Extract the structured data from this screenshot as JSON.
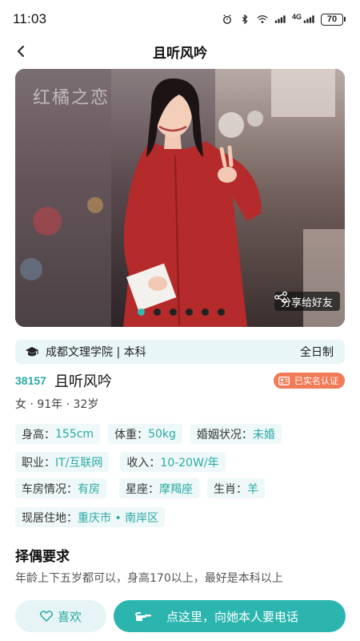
{
  "status_bar": {
    "time": "11:03",
    "battery": "70",
    "network_label": "4G"
  },
  "nav": {
    "title": "且听风吟"
  },
  "hero": {
    "watermark": "红橘之恋",
    "share_label": "分享给好友",
    "page_count": 6,
    "active_page": 1
  },
  "profile": {
    "school": "成都文理学院 | 本科",
    "study_mode": "全日制",
    "user_id": "38157",
    "nickname": "且听风吟",
    "verified_label": "已实名认证",
    "basic": "女 · 91年 · 32岁"
  },
  "details": {
    "row1": [
      {
        "label": "身高：",
        "value": "155cm"
      },
      {
        "label": "体重：",
        "value": "50kg"
      },
      {
        "label": "婚姻状况：",
        "value": "未婚"
      }
    ],
    "row2": [
      {
        "label": "职业：",
        "value": "IT/互联网"
      },
      {
        "label": "收入：",
        "value": "10-20W/年"
      }
    ],
    "row3": [
      {
        "label": "车房情况：",
        "value": "有房"
      },
      {
        "label": "星座：",
        "value": "摩羯座"
      },
      {
        "label": "生肖：",
        "value": "羊"
      }
    ],
    "row4": [
      {
        "label": "现居住地：",
        "value": "重庆市 • 南岸区"
      }
    ]
  },
  "requirements": {
    "title": "择偶要求",
    "text": "年龄上下五岁都可以，身高170以上，最好是本科以上"
  },
  "actions": {
    "like_label": "喜欢",
    "call_label": "点这里，向她本人要电话"
  },
  "colors": {
    "accent": "#2bb5ae",
    "accent_text": "#2aa9a5",
    "verify": "#f27b57",
    "tag_bg": "#eef8f8"
  }
}
